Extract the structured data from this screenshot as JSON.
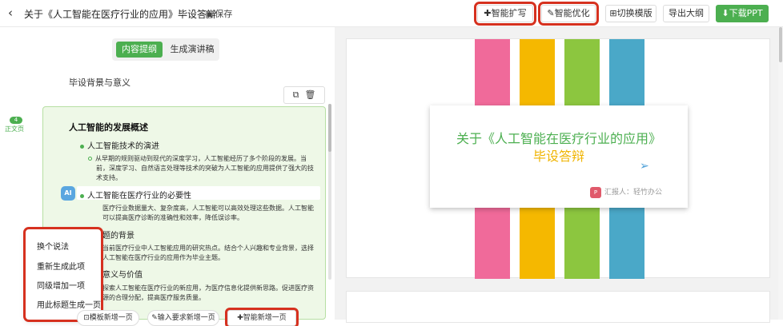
{
  "header": {
    "back_icon": "chevron-left-icon",
    "title": "关于《人工智能在医疗行业的应用》毕设答辩",
    "save_label": "保存",
    "buttons": {
      "smart_expand": "智能扩写",
      "smart_optimize": "智能优化",
      "switch_template": "切换模版",
      "export_outline": "导出大纲",
      "download_ppt": "下载PPT"
    }
  },
  "left": {
    "tabs": [
      "内容提纲",
      "生成演讲稿"
    ],
    "section_title": "毕设背景与意义",
    "page_badge": "4",
    "page_type": "正文页",
    "card": {
      "title": "人工智能的发展概述",
      "bullet1": "人工智能技术的演进",
      "bullet1_para": "从早期的规则驱动到现代的深度学习，人工智能经历了多个阶段的发展。当前，深度学习、自然语言处理等技术的突破为人工智能的应用提供了强大的技术支持。",
      "ai_badge": "AI",
      "bullet2": "人工智能在医疗行业的必要性",
      "bullet2_para": "医疗行业数据量大、复杂度高，人工智能可以高效处理这些数据。人工智能可以提高医疗诊断的准确性和效率，降低误诊率。",
      "sub3": "题的背景",
      "sub3_para": "当前医疗行业中人工智能应用的研究热点。结合个人兴趣和专业背景，选择人工智能在医疗行业的应用作为毕业主题。",
      "sub4": "意义与价值",
      "sub4_para": "探索人工智能在医疗行业的新应用，为医疗信息化提供新思路。促进医疗资源的合理分配，提高医疗服务质量。"
    },
    "context_menu": [
      "换个说法",
      "重新生成此项",
      "同级增加一项",
      "用此标题生成一页"
    ],
    "bottom_buttons": [
      "模板新增一页",
      "输入要求新增一页",
      "智能新增一页"
    ]
  },
  "preview": {
    "stripe_colors": [
      "#f06a9a",
      "#f5b800",
      "#8cc63f",
      "#4aa8c8"
    ],
    "title_line1": "关于《人工智能在医疗行业的应用》",
    "title_line2": "毕设答辩",
    "reporter": "汇报人：轻竹办公",
    "title_color1": "#4caf50",
    "title_color2": "#f0b400"
  }
}
